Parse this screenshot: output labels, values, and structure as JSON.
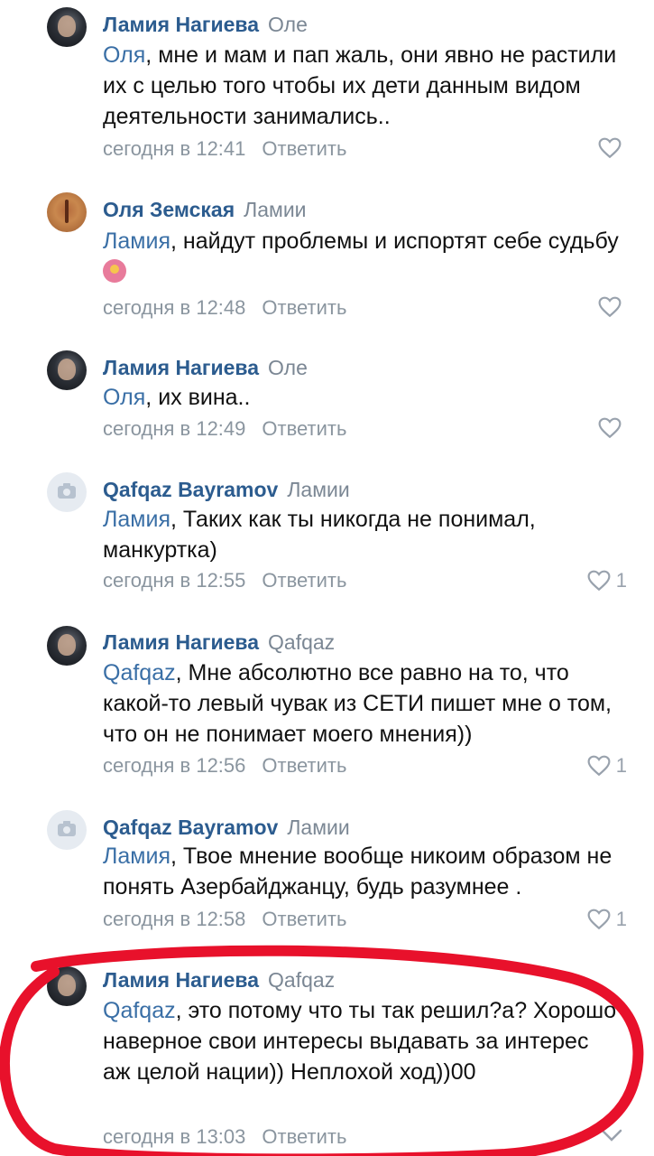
{
  "comments": [
    {
      "author": "Ламия Нагиева",
      "reply_to": "Оле",
      "mention": "Оля",
      "text": ", мне и мам и пап жаль, они явно не растили их с целью того чтобы их дети данным видом деятельности занимались..",
      "time": "сегодня в 12:41",
      "answer": "Ответить",
      "likes": ""
    },
    {
      "author": "Оля Земская",
      "reply_to": "Ламии",
      "mention": "Ламия",
      "text": ", найдут проблемы и испортят себе судьбу",
      "time": "сегодня в 12:48",
      "answer": "Ответить",
      "likes": ""
    },
    {
      "author": "Ламия Нагиева",
      "reply_to": "Оле",
      "mention": "Оля",
      "text": ", их вина..",
      "time": "сегодня в 12:49",
      "answer": "Ответить",
      "likes": ""
    },
    {
      "author": "Qafqaz Bayramov",
      "reply_to": "Ламии",
      "mention": "Ламия",
      "text": ", Таких как ты никогда не понимал, манкуртка)",
      "time": "сегодня в 12:55",
      "answer": "Ответить",
      "likes": "1"
    },
    {
      "author": "Ламия Нагиева",
      "reply_to": "Qafqaz",
      "mention": "Qafqaz",
      "text": ", Мне абсолютно все равно на то, что какой-то левый чувак из СЕТИ пишет мне о том, что он не понимает моего мнения))",
      "time": "сегодня в 12:56",
      "answer": "Ответить",
      "likes": "1"
    },
    {
      "author": "Qafqaz Bayramov",
      "reply_to": "Ламии",
      "mention": "Ламия",
      "text": ", Твое мнение вообще никоим образом не понять Азербайджанцу, будь разумнее .",
      "time": "сегодня в 12:58",
      "answer": "Ответить",
      "likes": "1"
    },
    {
      "author": "Ламия Нагиева",
      "reply_to": "Qafqaz",
      "mention": "Qafqaz",
      "text": ", это потому что ты так решил?а? Хорошо наверное свои интересы выдавать за интерес аж целой нации)) Неплохой ход))00",
      "time": "сегодня в 13:03",
      "answer": "Ответить",
      "likes": ""
    }
  ],
  "colors": {
    "author": "#2c5c8f",
    "mention": "#3a6fa6",
    "meta": "#8a959f",
    "highlight": "#e8112b"
  }
}
